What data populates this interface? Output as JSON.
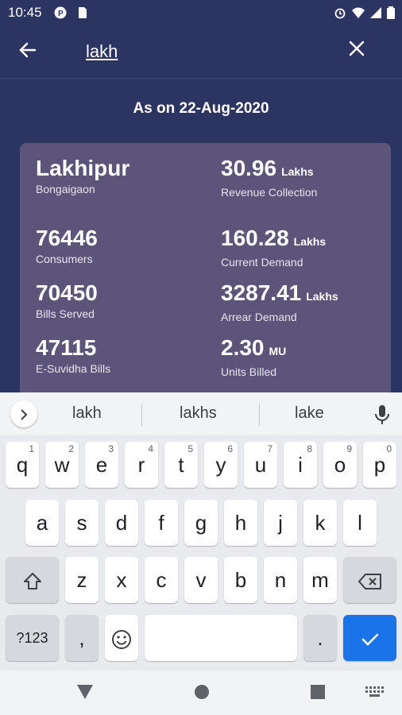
{
  "status_bar": {
    "time": "10:45"
  },
  "search": {
    "query": "lakh"
  },
  "as_on": "As on 22-Aug-2020",
  "card": {
    "name": "Lakhipur",
    "district": "Bongaigaon",
    "revenue": {
      "value": "30.96",
      "unit": "Lakhs",
      "label": "Revenue Collection"
    },
    "consumers": {
      "value": "76446",
      "label": "Consumers"
    },
    "current_demand": {
      "value": "160.28",
      "unit": "Lakhs",
      "label": "Current Demand"
    },
    "bills_served": {
      "value": "70450",
      "label": "Bills Served"
    },
    "arrear_demand": {
      "value": "3287.41",
      "unit": "Lakhs",
      "label": "Arrear Demand"
    },
    "esuvidha": {
      "value": "47115",
      "label": "E-Suvidha Bills"
    },
    "units_billed": {
      "value": "2.30",
      "unit": "MU",
      "label": "Units Billed"
    }
  },
  "keyboard": {
    "suggestions": [
      "lakh",
      "lakhs",
      "lake"
    ],
    "row1": [
      "q",
      "w",
      "e",
      "r",
      "t",
      "y",
      "u",
      "i",
      "o",
      "p"
    ],
    "row1_hints": [
      "1",
      "2",
      "3",
      "4",
      "5",
      "6",
      "7",
      "8",
      "9",
      "0"
    ],
    "row2": [
      "a",
      "s",
      "d",
      "f",
      "g",
      "h",
      "j",
      "k",
      "l"
    ],
    "row3": [
      "z",
      "x",
      "c",
      "v",
      "b",
      "n",
      "m"
    ],
    "symbols_label": "?123",
    "comma": ",",
    "period": "."
  },
  "icons": {
    "back": "arrow-left-icon",
    "clear": "close-icon",
    "expand": "chevron-right-icon",
    "mic": "microphone-icon",
    "shift": "shift-icon",
    "backspace": "backspace-icon",
    "emoji": "emoji-icon",
    "done": "checkmark-icon"
  },
  "colors": {
    "background": "#2c3561",
    "card": "#5d5579",
    "accent": "#1a73e8"
  }
}
